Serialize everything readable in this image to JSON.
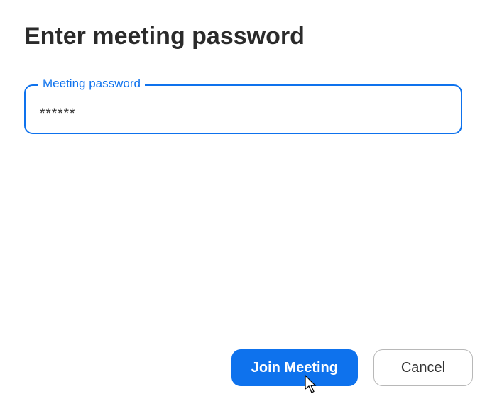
{
  "dialog": {
    "title": "Enter meeting password",
    "password_field": {
      "label": "Meeting password",
      "value": "******"
    },
    "buttons": {
      "primary": "Join Meeting",
      "secondary": "Cancel"
    }
  },
  "colors": {
    "accent": "#0e72ed"
  }
}
